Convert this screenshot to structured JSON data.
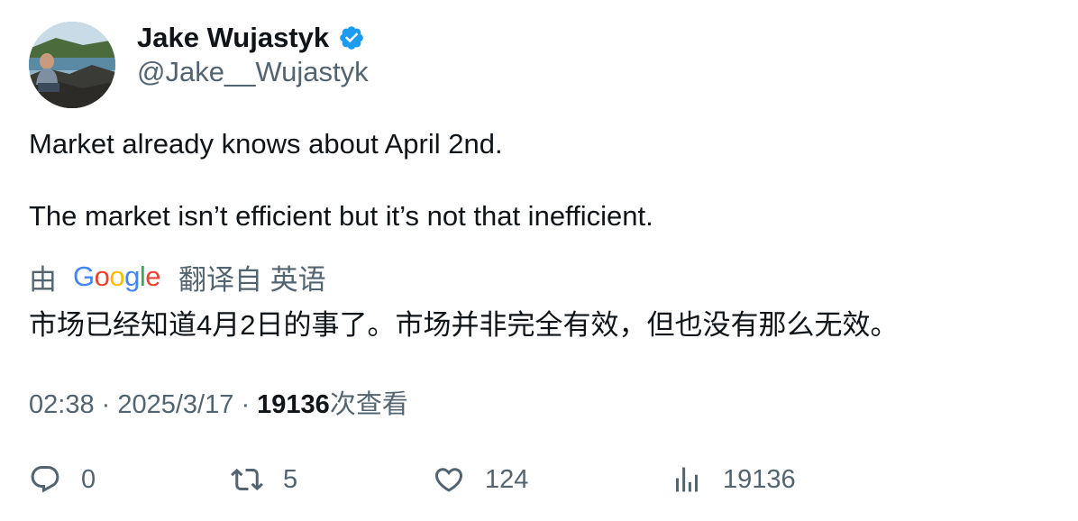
{
  "author": {
    "display_name": "Jake Wujastyk",
    "handle": "@Jake__Wujastyk",
    "verified": true,
    "verified_color": "#1d9bf0"
  },
  "tweet": {
    "line1": "Market already knows about April 2nd.",
    "line2": "The market isn’t efficient but it’s not that inefficient."
  },
  "translation": {
    "prefix": "由",
    "provider": "Google",
    "suffix": "翻译自 英语",
    "text": "市场已经知道4月2日的事了。市场并非完全有效，但也没有那么无效。"
  },
  "meta": {
    "time": "02:38",
    "separator": "·",
    "date": "2025/3/17",
    "views_count": "19136",
    "views_label": "次查看"
  },
  "actions": {
    "replies": "0",
    "retweets": "5",
    "likes": "124",
    "views": "19136"
  },
  "colors": {
    "text_primary": "#0f1419",
    "text_secondary": "#536471",
    "google_blue": "#4285f4",
    "google_red": "#ea4335",
    "google_yellow": "#fbbc05",
    "google_green": "#34a853"
  }
}
